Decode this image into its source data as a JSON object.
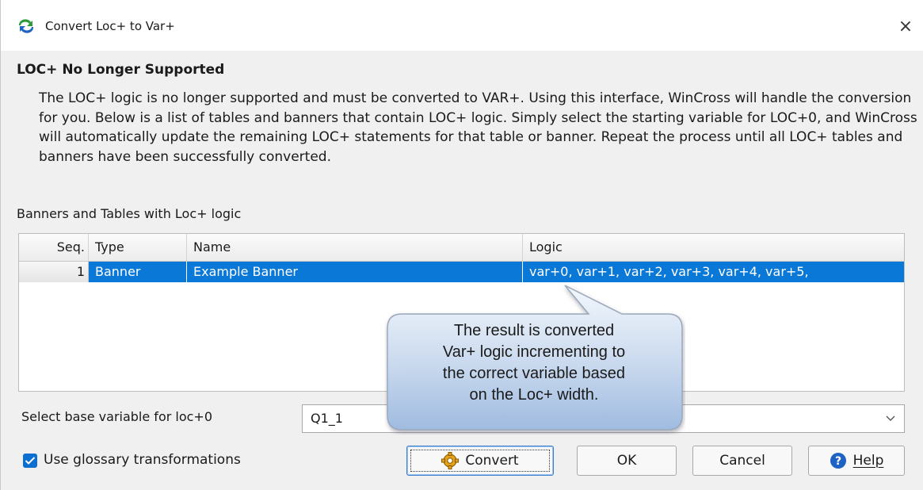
{
  "window": {
    "title": "Convert Loc+ to Var+",
    "close_glyph": "×"
  },
  "section": {
    "title": "LOC+ No Longer Supported",
    "description": "The LOC+ logic is no longer supported and must be converted to VAR+. Using this interface, WinCross will handle the conversion for you. Below is a list of tables and banners that contain LOC+ logic. Simply select the starting variable for LOC+0, and WinCross will automatically update the remaining LOC+ statements for that table or banner. Repeat the process until all LOC+ tables and banners have been successfully converted."
  },
  "grid": {
    "label": "Banners and Tables with Loc+ logic",
    "columns": [
      "Seq.",
      "Type",
      "Name",
      "Logic"
    ],
    "rows": [
      {
        "seq": "1",
        "type": "Banner",
        "name": "Example Banner",
        "logic": "var+0, var+1, var+2, var+3, var+4, var+5,"
      }
    ]
  },
  "base_variable": {
    "label": "Select base variable for loc+0",
    "value": "Q1_1"
  },
  "options": {
    "glossary_label": "Use glossary transformations",
    "glossary_checked": true
  },
  "buttons": {
    "convert": "Convert",
    "ok": "OK",
    "cancel": "Cancel",
    "help": "Help"
  },
  "callout": {
    "text_lines": [
      "The result is converted",
      "Var+ logic incrementing to",
      "the correct variable based",
      "on the Loc+ width."
    ]
  },
  "icons": {
    "title": "refresh-arrows-icon",
    "convert": "gear-cog-icon",
    "help": "question-mark-icon",
    "dropdown": "chevron-down-icon"
  },
  "colors": {
    "selection": "#0a78d7",
    "accent": "#0a6fd1"
  }
}
